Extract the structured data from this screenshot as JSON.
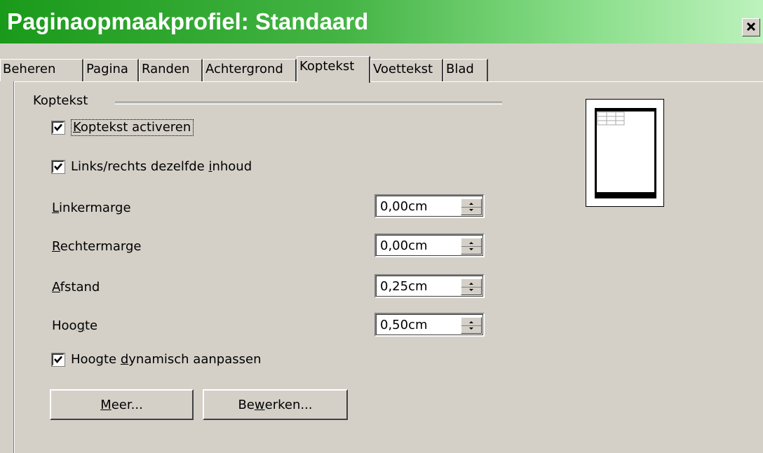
{
  "window": {
    "title": "Paginaopmaakprofiel: Standaard",
    "close_label": "✕"
  },
  "tabs": [
    {
      "label": "Beheren"
    },
    {
      "label": "Pagina"
    },
    {
      "label": "Randen"
    },
    {
      "label": "Achtergrond"
    },
    {
      "label": "Koptekst",
      "active": true
    },
    {
      "label": "Voettekst"
    },
    {
      "label": "Blad"
    }
  ],
  "group": {
    "label": "Koptekst"
  },
  "checkboxes": {
    "activate": {
      "pre": "",
      "mnemonic": "K",
      "post": "optekst activeren",
      "checked": true
    },
    "same_content": {
      "pre": "Links/rechts dezelfde ",
      "mnemonic": "i",
      "post": "nhoud",
      "checked": true
    },
    "dynamic_height": {
      "pre": "Hoogte ",
      "mnemonic": "d",
      "post": "ynamisch aanpassen",
      "checked": true
    }
  },
  "fields": {
    "left_margin": {
      "pre": "",
      "mnemonic": "L",
      "post": "inkermarge",
      "value": "0,00cm"
    },
    "right_margin": {
      "pre": "",
      "mnemonic": "R",
      "post": "echtermarge",
      "value": "0,00cm"
    },
    "spacing": {
      "pre": "",
      "mnemonic": "A",
      "post": "fstand",
      "value": "0,25cm"
    },
    "height": {
      "pre": "Hoo",
      "mnemonic": "g",
      "post": "te",
      "value": "0,50cm"
    }
  },
  "buttons": {
    "more": {
      "pre": "",
      "mnemonic": "M",
      "post": "eer..."
    },
    "edit": {
      "pre": "Be",
      "mnemonic": "w",
      "post": "erken..."
    }
  }
}
